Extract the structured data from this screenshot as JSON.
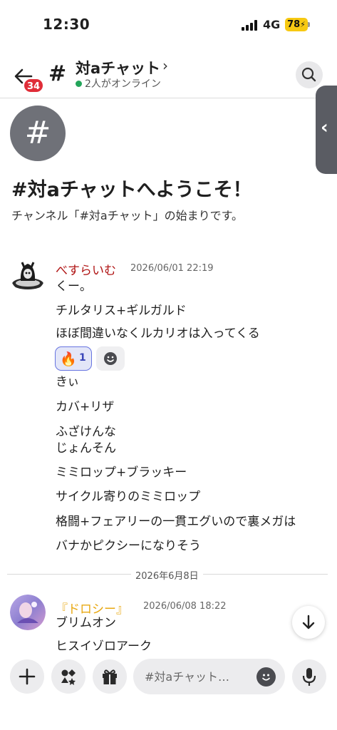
{
  "status_bar": {
    "time": "12:30",
    "network": "4G",
    "battery": "78"
  },
  "header": {
    "badge_count": "34",
    "channel_title": "対aチャット",
    "online_text": "2人がオンライン"
  },
  "welcome": {
    "icon": "#",
    "title": "#対aチャットへようこそ！",
    "subtitle": "チャンネル「#対aチャット」の始まりです。"
  },
  "messages": [
    {
      "author": "べすらいむ",
      "author_color": "#b01515",
      "timestamp": "2026/06/01 22:19",
      "lines": [
        "くー。",
        "チルタリス+ギルガルド",
        "ほぼ間違いなくルカリオは入ってくる",
        "きぃ",
        "カバ+リザ",
        "ふざけんな",
        "じょんそん",
        "ミミロップ+ブラッキー",
        "サイクル寄りのミミロップ",
        "格闘+フェアリーの一貫エグいので裏メガは",
        "バナかピクシーになりそう"
      ],
      "reaction": {
        "emoji": "🔥",
        "count": "1"
      }
    },
    {
      "author": "『ドロシー』",
      "author_color": "#e8a812",
      "timestamp": "2026/06/08 18:22",
      "lines": [
        "ブリムオン",
        "ヒスイゾロアーク"
      ]
    }
  ],
  "date_divider": "2026年6月8日",
  "composer": {
    "placeholder": "#対aチャット…"
  },
  "icons": [
    "back-arrow-icon",
    "hash-icon",
    "chevron-right-icon",
    "search-icon",
    "panel-chevron-icon",
    "smiley-icon",
    "arrow-down-icon",
    "plus-icon",
    "apps-icon",
    "gift-icon",
    "microphone-icon"
  ]
}
